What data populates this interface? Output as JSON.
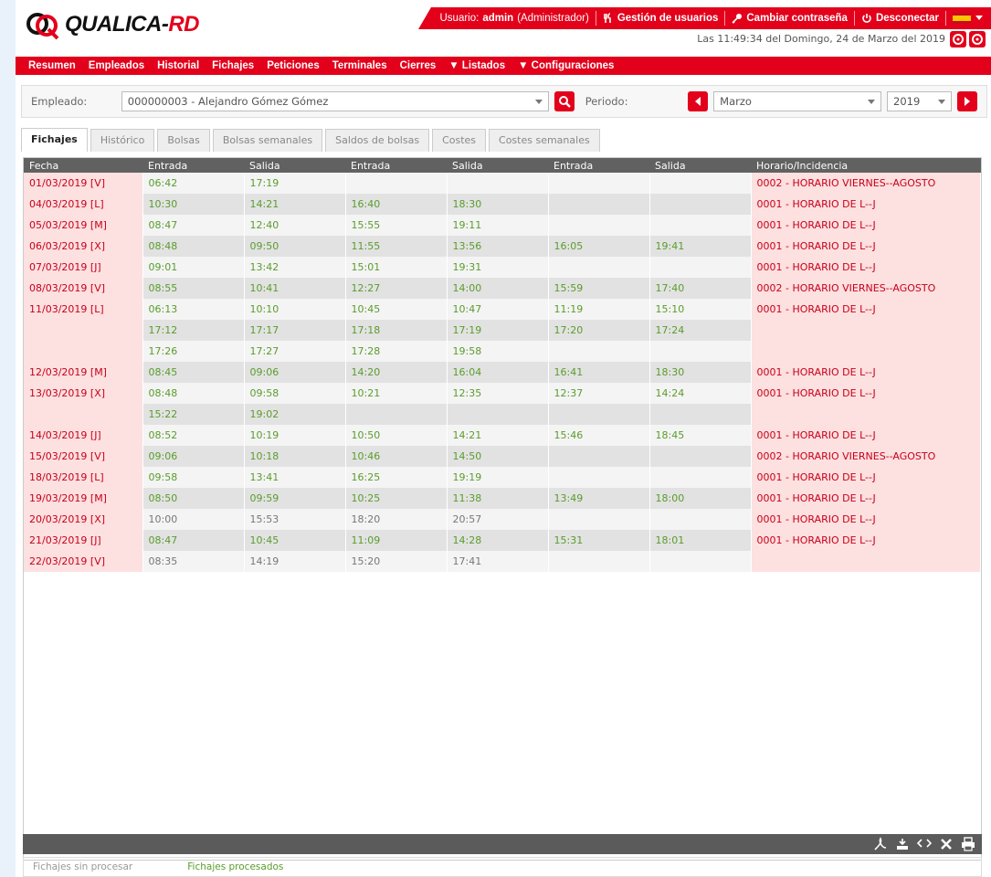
{
  "brand": {
    "name": "QUALICA-",
    "suffix": "RD"
  },
  "topbar": {
    "user_prefix": "Usuario:",
    "user_name": "admin",
    "user_role": "(Administrador)",
    "users_link": "Gestión de usuarios",
    "password_link": "Cambiar contraseña",
    "logout_link": "Desconectar"
  },
  "datetime": "Las 11:49:34 del Domingo, 24 de Marzo del 2019",
  "menu": [
    "Resumen",
    "Empleados",
    "Historial",
    "Fichajes",
    "Peticiones",
    "Terminales",
    "Cierres",
    "▼ Listados",
    "▼ Configuraciones"
  ],
  "filter": {
    "employee_label": "Empleado:",
    "employee_value": "000000003 - Alejandro Gómez Gómez",
    "period_label": "Periodo:",
    "month": "Marzo",
    "year": "2019"
  },
  "tabs": [
    "Fichajes",
    "Histórico",
    "Bolsas",
    "Bolsas semanales",
    "Saldos de bolsas",
    "Costes",
    "Costes semanales"
  ],
  "columns": [
    "Fecha",
    "Entrada",
    "Salida",
    "Entrada",
    "Salida",
    "Entrada",
    "Salida",
    "Horario/Incidencia"
  ],
  "rows": [
    {
      "date": "01/03/2019 [V]",
      "t": [
        "06:42",
        "17:19",
        "",
        "",
        "",
        ""
      ],
      "inc": "0002 - HORARIO VIERNES--AGOSTO"
    },
    {
      "date": "04/03/2019 [L]",
      "t": [
        "10:30",
        "14:21",
        "16:40",
        "18:30",
        "",
        ""
      ],
      "inc": "0001 - HORARIO DE L--J"
    },
    {
      "date": "05/03/2019 [M]",
      "t": [
        "08:47",
        "12:40",
        "15:55",
        "19:11",
        "",
        ""
      ],
      "inc": "0001 - HORARIO DE L--J"
    },
    {
      "date": "06/03/2019 [X]",
      "t": [
        "08:48",
        "09:50",
        "11:55",
        "13:56",
        "16:05",
        "19:41"
      ],
      "inc": "0001 - HORARIO DE L--J"
    },
    {
      "date": "07/03/2019 [J]",
      "t": [
        "09:01",
        "13:42",
        "15:01",
        "19:31",
        "",
        ""
      ],
      "inc": "0001 - HORARIO DE L--J"
    },
    {
      "date": "08/03/2019 [V]",
      "t": [
        "08:55",
        "10:41",
        "12:27",
        "14:00",
        "15:59",
        "17:40"
      ],
      "inc": "0002 - HORARIO VIERNES--AGOSTO"
    },
    {
      "date": "11/03/2019 [L]",
      "t": [
        "06:13",
        "10:10",
        "10:45",
        "10:47",
        "11:19",
        "15:10"
      ],
      "inc": "0001 - HORARIO DE L--J"
    },
    {
      "date": "",
      "t": [
        "17:12",
        "17:17",
        "17:18",
        "17:19",
        "17:20",
        "17:24"
      ],
      "inc": ""
    },
    {
      "date": "",
      "t": [
        "17:26",
        "17:27",
        "17:28",
        "19:58",
        "",
        ""
      ],
      "inc": ""
    },
    {
      "date": "12/03/2019 [M]",
      "t": [
        "08:45",
        "09:06",
        "14:20",
        "16:04",
        "16:41",
        "18:30"
      ],
      "inc": "0001 - HORARIO DE L--J"
    },
    {
      "date": "13/03/2019 [X]",
      "t": [
        "08:48",
        "09:58",
        "10:21",
        "12:35",
        "12:37",
        "14:24"
      ],
      "inc": "0001 - HORARIO DE L--J"
    },
    {
      "date": "",
      "t": [
        "15:22",
        "19:02",
        "",
        "",
        "",
        ""
      ],
      "inc": ""
    },
    {
      "date": "14/03/2019 [J]",
      "t": [
        "08:52",
        "10:19",
        "10:50",
        "14:21",
        "15:46",
        "18:45"
      ],
      "inc": "0001 - HORARIO DE L--J"
    },
    {
      "date": "15/03/2019 [V]",
      "t": [
        "09:06",
        "10:18",
        "10:46",
        "14:50",
        "",
        ""
      ],
      "inc": "0002 - HORARIO VIERNES--AGOSTO"
    },
    {
      "date": "18/03/2019 [L]",
      "t": [
        "09:58",
        "13:41",
        "16:25",
        "19:19",
        "",
        ""
      ],
      "inc": "0001 - HORARIO DE L--J"
    },
    {
      "date": "19/03/2019 [M]",
      "t": [
        "08:50",
        "09:59",
        "10:25",
        "11:38",
        "13:49",
        "18:00"
      ],
      "inc": "0001 - HORARIO DE L--J"
    },
    {
      "date": "20/03/2019 [X]",
      "t": [
        "10:00",
        "15:53",
        "18:20",
        "20:57",
        "",
        ""
      ],
      "inc": "0001 - HORARIO DE L--J"
    },
    {
      "date": "21/03/2019 [J]",
      "t": [
        "08:47",
        "10:45",
        "11:09",
        "14:28",
        "15:31",
        "18:01"
      ],
      "inc": "0001 - HORARIO DE L--J"
    },
    {
      "date": "22/03/2019 [V]",
      "t": [
        "08:35",
        "14:19",
        "15:20",
        "17:41",
        "",
        ""
      ],
      "inc": ""
    }
  ],
  "export_icons": [
    "pdf-icon",
    "csv-icon",
    "xml-icon",
    "excel-icon",
    "print-icon"
  ],
  "legend": {
    "unprocessed": "Fichajes sin procesar",
    "processed": "Fichajes procesados"
  },
  "colors": {
    "brand_red": "#e3001b",
    "processed_green": "#5a9c2c",
    "unprocessed_gray": "#777777",
    "incident_red": "#c8001a"
  }
}
